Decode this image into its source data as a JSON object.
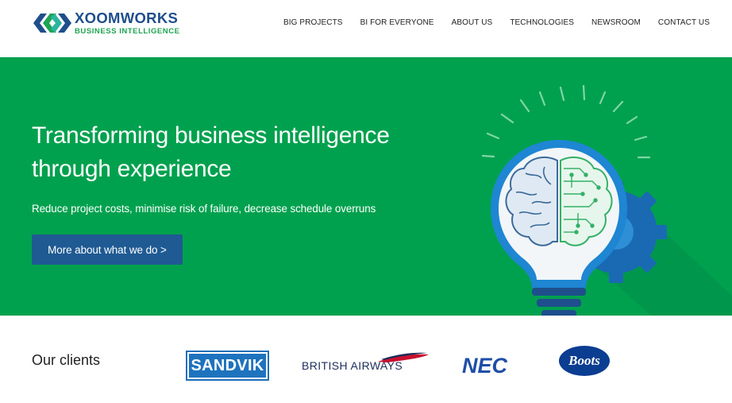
{
  "brand": {
    "title": "XOOMWORKS",
    "subtitle": "BUSINESS INTELLIGENCE",
    "colors": {
      "blue": "#1f4e8c",
      "green": "#1fa453"
    }
  },
  "nav": {
    "items": [
      {
        "label": "BIG PROJECTS"
      },
      {
        "label": "BI FOR EVERYONE"
      },
      {
        "label": "ABOUT US"
      },
      {
        "label": "TECHNOLOGIES"
      },
      {
        "label": "NEWSROOM"
      },
      {
        "label": "CONTACT US"
      }
    ]
  },
  "hero": {
    "title": "Transforming business intelligence through experience",
    "subtitle": "Reduce project costs, minimise risk of failure, decrease schedule overruns",
    "button_label": "More about what we do >",
    "illustration": "lightbulb-brain-gear-icon",
    "background_color": "#00a14e",
    "button_color": "#1f5a93"
  },
  "clients": {
    "label": "Our clients",
    "logos": [
      {
        "name": "SANDVIK"
      },
      {
        "name": "BRITISH AIRWAYS"
      },
      {
        "name": "NEC"
      },
      {
        "name": "Boots"
      }
    ]
  }
}
